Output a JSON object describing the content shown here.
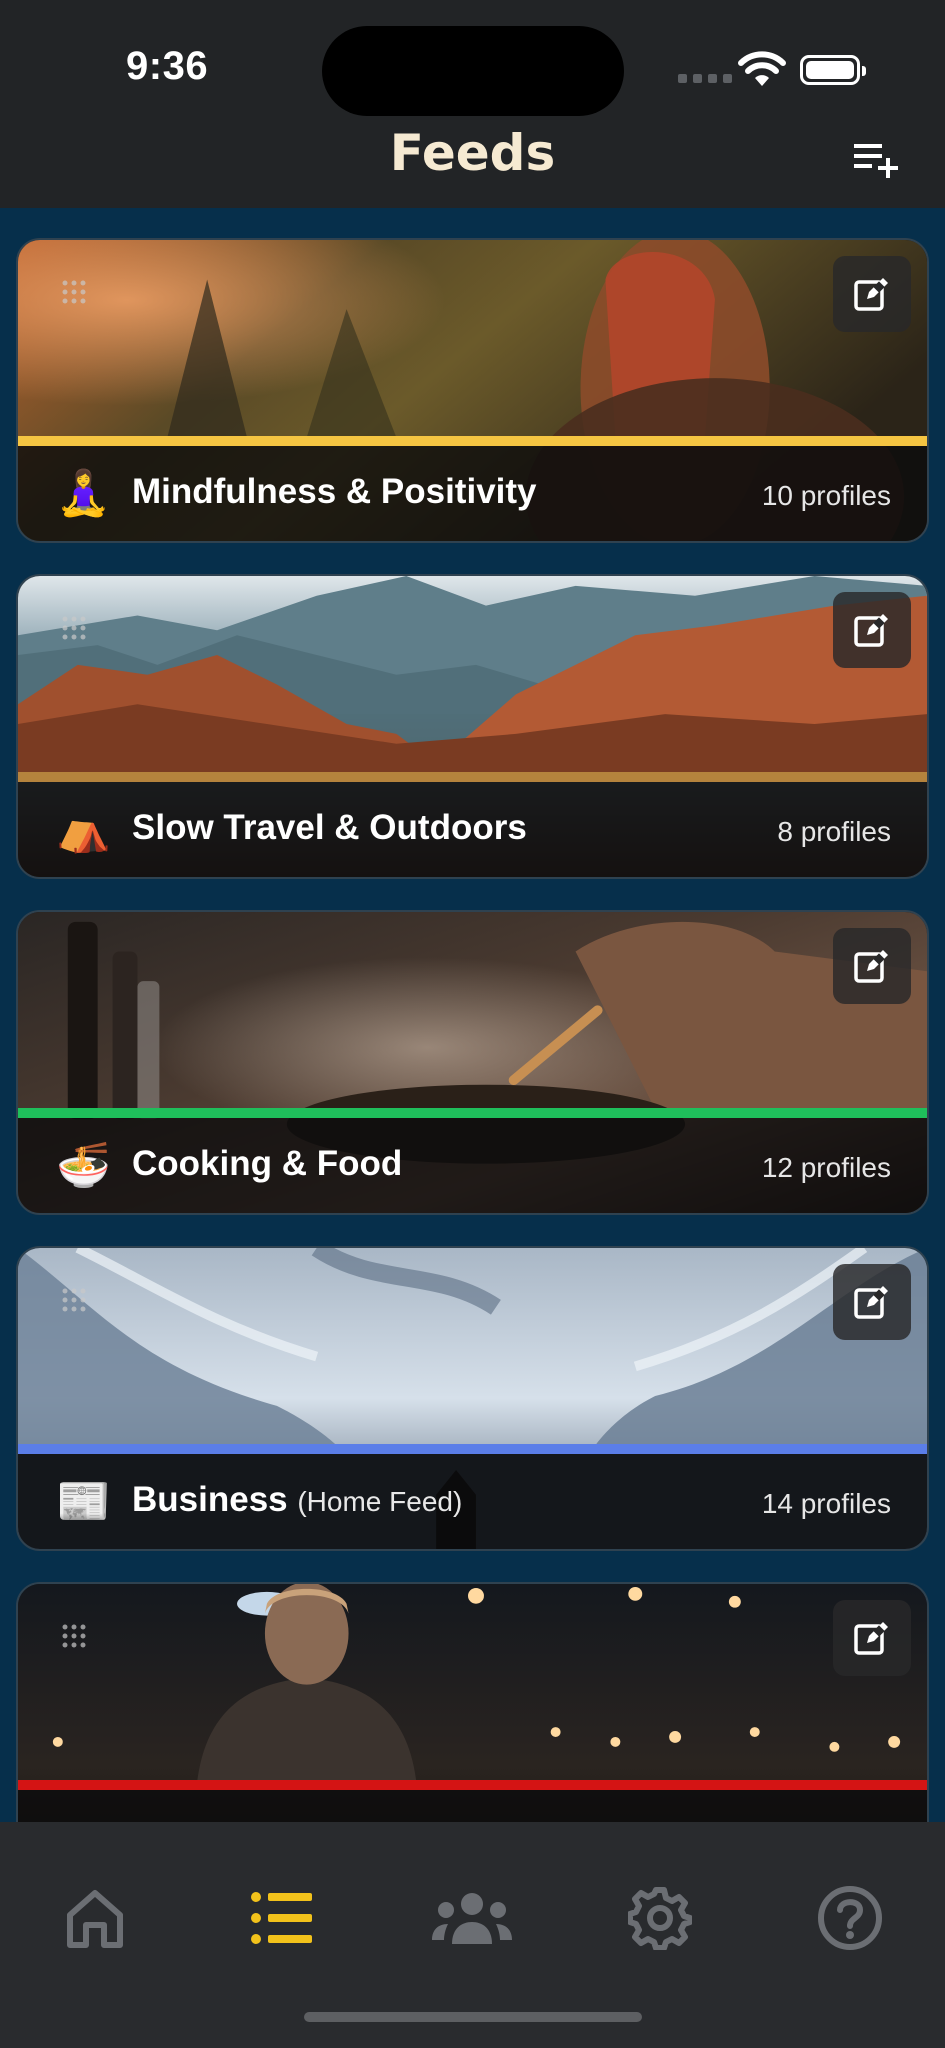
{
  "status_bar": {
    "time": "9:36"
  },
  "header": {
    "title": "Feeds",
    "add_icon": "playlist-add-icon"
  },
  "feeds": [
    {
      "emoji": "🧘‍♀️",
      "name": "Mindfulness & Positivity",
      "note": "",
      "count": "10 profiles",
      "accent": "#f5c542"
    },
    {
      "emoji": "⛺",
      "name": "Slow Travel & Outdoors",
      "note": "",
      "count": "8 profiles",
      "accent": "#b5833d"
    },
    {
      "emoji": "🍜",
      "name": "Cooking & Food",
      "note": "",
      "count": "12 profiles",
      "accent": "#1fbf5b"
    },
    {
      "emoji": "📰",
      "name": "Business",
      "note": "(Home Feed)",
      "count": "14 profiles",
      "accent": "#5b7ee8"
    },
    {
      "emoji": "",
      "name": "",
      "note": "",
      "count": "",
      "accent": "#d41414"
    }
  ],
  "tabbar": {
    "active_color": "#f2c21b",
    "inactive_color": "#6b6e73",
    "tabs": [
      {
        "icon": "home-icon",
        "active": false
      },
      {
        "icon": "feeds-list-icon",
        "active": true
      },
      {
        "icon": "people-icon",
        "active": false
      },
      {
        "icon": "settings-gear-icon",
        "active": false
      },
      {
        "icon": "help-icon",
        "active": false
      }
    ]
  }
}
